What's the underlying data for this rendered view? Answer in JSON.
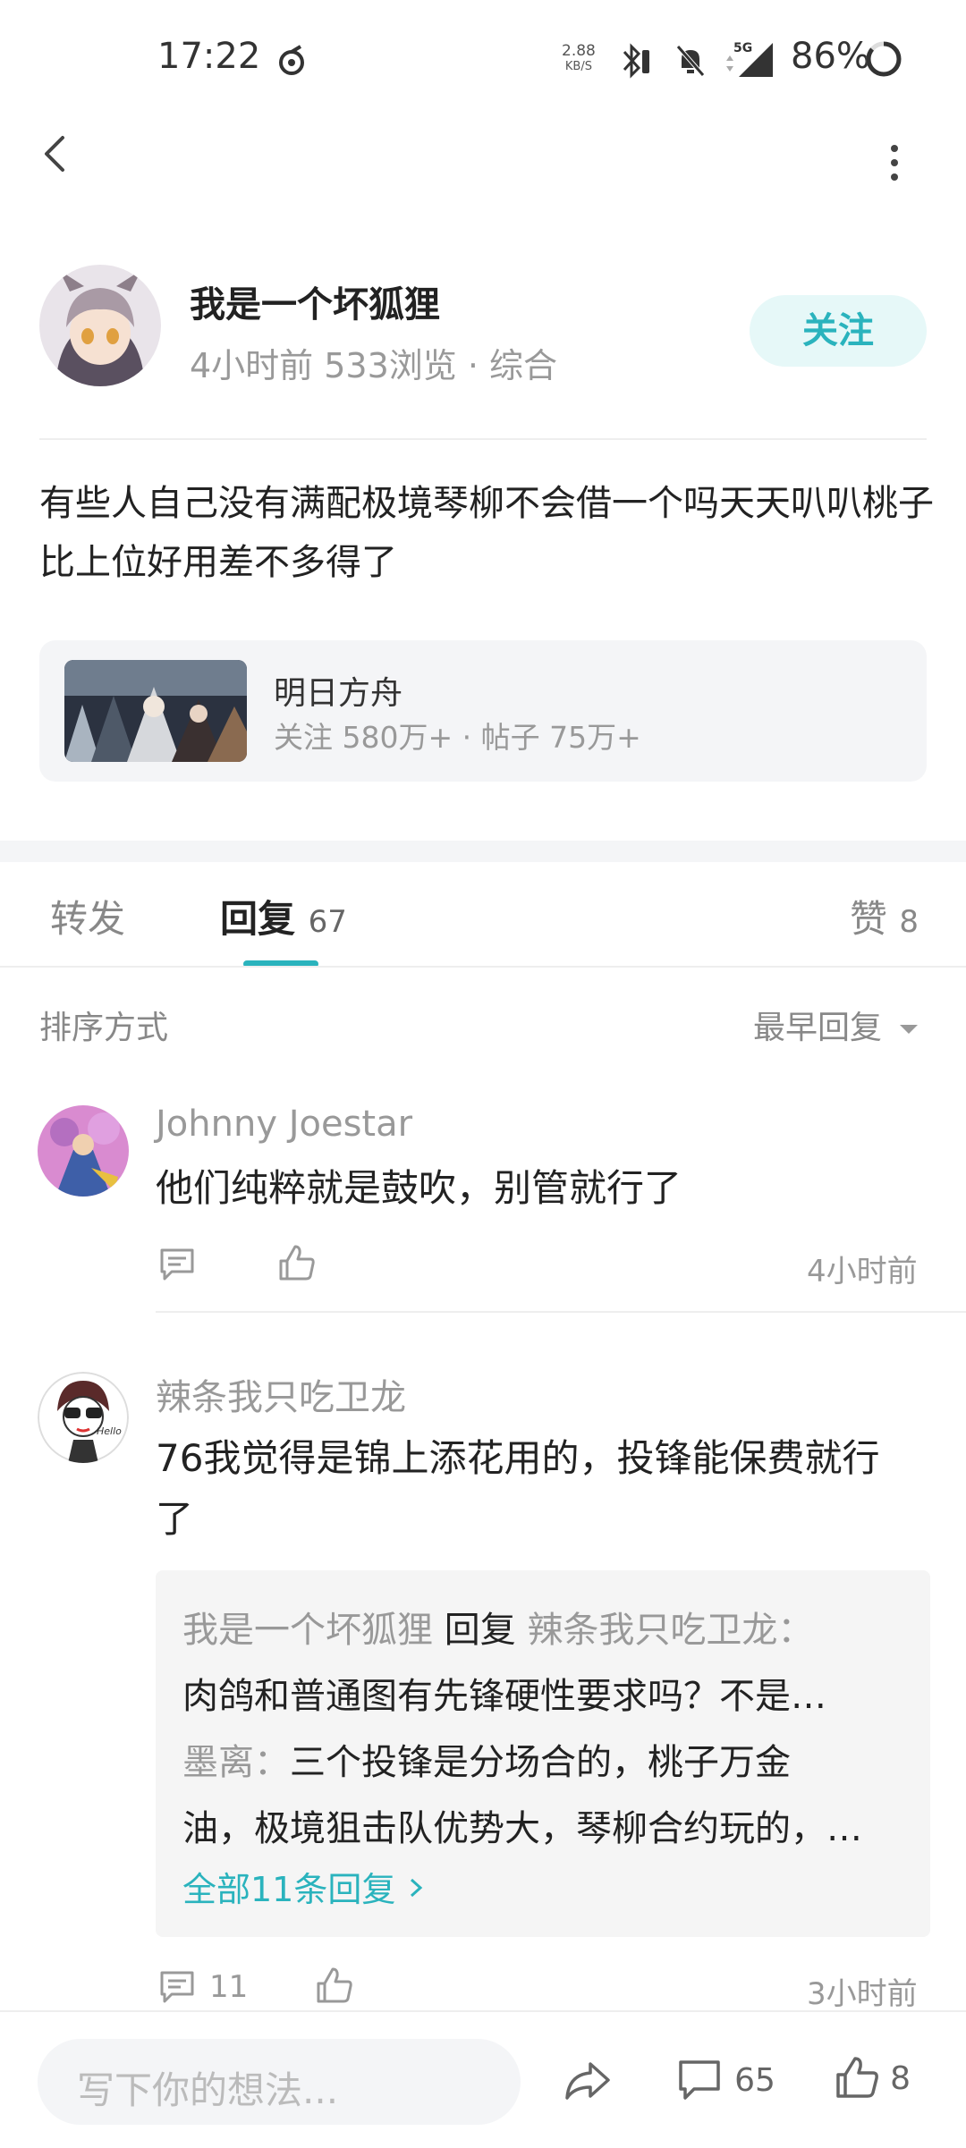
{
  "status_bar": {
    "time": "17:22",
    "net_speed_value": "2.88",
    "net_speed_unit": "KB/S",
    "network": "5G",
    "battery": "86%"
  },
  "post": {
    "author": "我是一个坏狐狸",
    "meta": "4小时前  533浏览  ·  综合",
    "follow_label": "关注",
    "content": "有些人自己没有满配极境琴柳不会借一个吗天天叭叭桃子比上位好用差不多得了"
  },
  "game_card": {
    "name": "明日方舟",
    "stats": "关注 580万+  ·  帖子 75万+"
  },
  "tabs": {
    "repost": "转发",
    "reply": "回复",
    "reply_count": "67",
    "like": "赞",
    "like_count": "8"
  },
  "sort": {
    "label": "排序方式",
    "value": "最早回复"
  },
  "comments": [
    {
      "author": "Johnny Joestar",
      "text": "他们纯粹就是鼓吹，别管就行了",
      "time": "4小时前",
      "reply_count": ""
    },
    {
      "author": "辣条我只吃卫龙",
      "text_line1": "76我觉得是锦上添花用的，投锋能保费就行",
      "text_line2": "了",
      "time": "3小时前",
      "reply_count": "11",
      "replies": {
        "r1_author": "我是一个坏狐狸",
        "r1_verb": " 回复 ",
        "r1_target": "辣条我只吃卫龙：",
        "r1_text": "肉鸽和普通图有先锋硬性要求吗？不是…",
        "r2_author": "墨离：",
        "r2_text_line1": "三个投锋是分场合的，桃子万金",
        "r2_text_line2": "油，极境狙击队优势大，琴柳合约玩的，…",
        "view_all": "全部11条回复"
      }
    }
  ],
  "bottom_bar": {
    "input_placeholder": "写下你的想法...",
    "comment_count": "65",
    "like_count": "8"
  },
  "colors": {
    "accent": "#2ab3bd",
    "follow_bg": "#e6f8f8",
    "card_bg": "#f4f5f7"
  }
}
